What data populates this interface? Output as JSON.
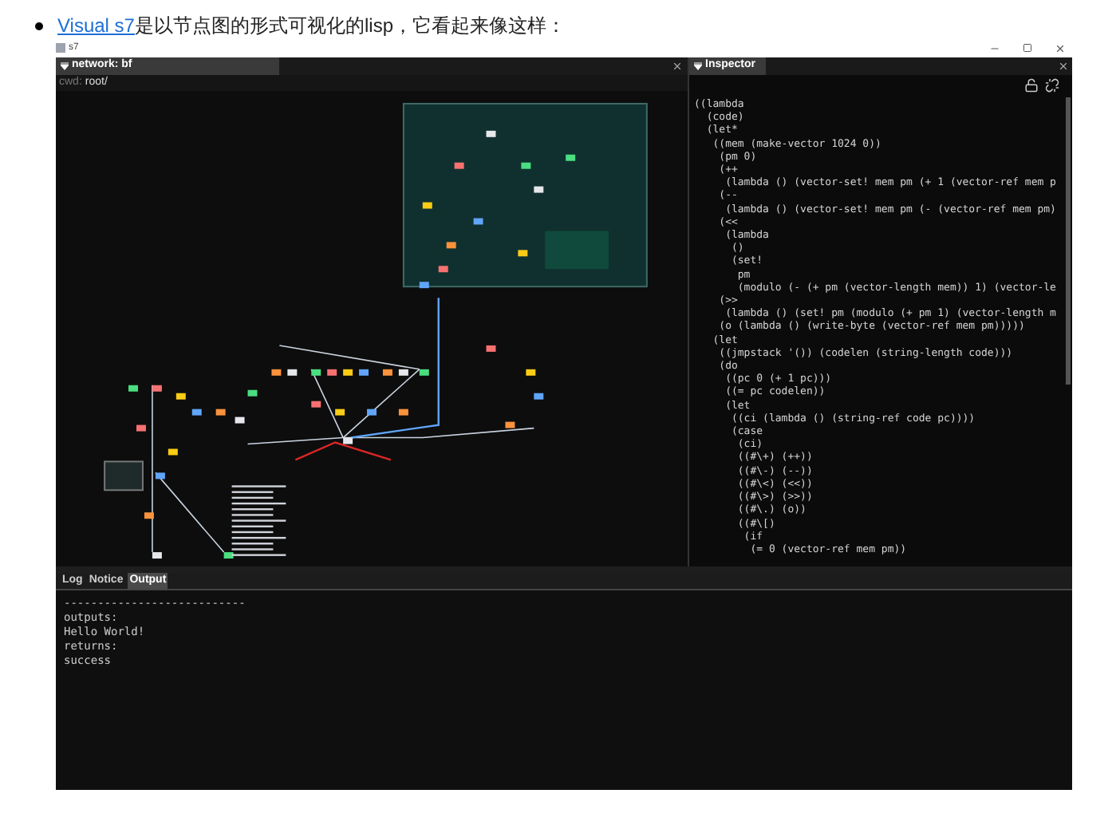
{
  "intro": {
    "link": "Visual s7",
    "text": "是以节点图的形式可视化的lisp，它看起来像这样："
  },
  "window": {
    "title": "s7"
  },
  "network_panel": {
    "title": "network: bf",
    "cwd_label": "cwd:",
    "cwd": "root/"
  },
  "inspector": {
    "title": "Inspector",
    "code_lines": [
      "((lambda",
      "  (code)",
      "  (let*",
      "   ((mem (make-vector 1024 0))",
      "    (pm 0)",
      "    (++",
      "     (lambda () (vector-set! mem pm (+ 1 (vector-ref mem p",
      "    (--",
      "     (lambda () (vector-set! mem pm (- (vector-ref mem pm)",
      "    (<<",
      "     (lambda",
      "      ()",
      "      (set!",
      "       pm",
      "       (modulo (- (+ pm (vector-length mem)) 1) (vector-le",
      "    (>>",
      "     (lambda () (set! pm (modulo (+ pm 1) (vector-length m",
      "    (o (lambda () (write-byte (vector-ref mem pm)))))",
      "   (let",
      "    ((jmpstack '()) (codelen (string-length code)))",
      "    (do",
      "     ((pc 0 (+ 1 pc)))",
      "     ((= pc codelen))",
      "     (let",
      "      ((ci (lambda () (string-ref code pc))))",
      "      (case",
      "       (ci)",
      "       ((#\\+) (++))",
      "       ((#\\-) (--))",
      "       ((#\\<) (<<))",
      "       ((#\\>) (>>))",
      "       ((#\\.) (o))",
      "       ((#\\[)",
      "        (if",
      "         (= 0 (vector-ref mem pm))"
    ]
  },
  "bottom_panel": {
    "tabs": [
      {
        "label": "Log",
        "selected": false
      },
      {
        "label": "Notice",
        "selected": false
      },
      {
        "label": "Output",
        "selected": true
      }
    ],
    "output_lines": [
      "---------------------------",
      "outputs:",
      "Hello World!",
      "returns:",
      "success"
    ]
  }
}
